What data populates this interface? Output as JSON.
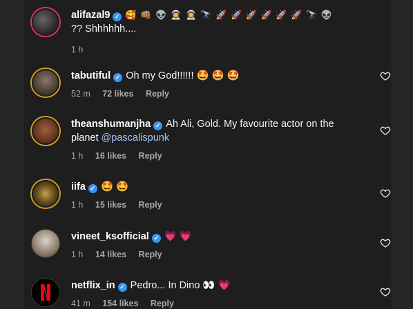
{
  "comments": [
    {
      "username": "alifazal9",
      "text_line1": "🥰 👊🏽 👽 👨‍🚀 👨‍🚀 🔭 🚀 🚀 🚀 🚀 🚀 🚀 🔭 👽",
      "text_line2": "?? Shhhhhh....",
      "time": "1 h",
      "likes": "",
      "reply": ""
    },
    {
      "username": "tabutiful",
      "text": "Oh my God!!!!!! 🤩 🤩 🤩",
      "time": "52 m",
      "likes": "72 likes",
      "reply": "Reply"
    },
    {
      "username": "theanshumanjha",
      "text": "Ah Ali, Gold. My favourite actor on the",
      "text_line2": "planet",
      "mention": "@pascalispunk",
      "time": "1 h",
      "likes": "16 likes",
      "reply": "Reply"
    },
    {
      "username": "iifa",
      "text": "🤩 🤩",
      "time": "1 h",
      "likes": "15 likes",
      "reply": "Reply"
    },
    {
      "username": "vineet_ksofficial",
      "text": "💗 💗",
      "time": "1 h",
      "likes": "14 likes",
      "reply": "Reply"
    },
    {
      "username": "netflix_in",
      "text": "Pedro... In Dino 👀 💗",
      "time": "41 m",
      "likes": "154 likes",
      "reply": "Reply"
    }
  ],
  "icons": {
    "verified": "verified-badge-icon",
    "heart": "heart-outline-icon"
  },
  "colors": {
    "background": "#1e1e1e",
    "verified": "#3897f0",
    "mention": "#a3c3ff",
    "meta": "#a8a8a8"
  }
}
